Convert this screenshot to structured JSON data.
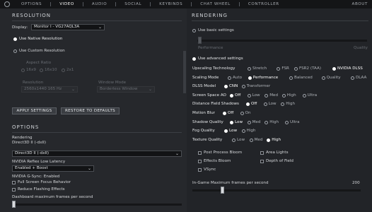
{
  "nav": {
    "tabs": [
      "OPTIONS",
      "VIDEO",
      "AUDIO",
      "SOCIAL",
      "KEYBINDS",
      "CHAT WHEEL",
      "CONTROLLER"
    ],
    "active": "VIDEO",
    "about": "ABOUT"
  },
  "resolution": {
    "title": "RESOLUTION",
    "display_label": "Display:",
    "display_value": "Monitor I - VG27AQL3A",
    "use_native": "Use Native Resolution",
    "use_custom": "Use Custom Resolution",
    "aspect_ratio_label": "Aspect Ratio",
    "aspect_options": [
      "16x9",
      "16x10",
      "2x1"
    ],
    "resolution_label": "Resolution",
    "resolution_value": "2560x1440 165 Hz",
    "window_mode_label": "Window Mode",
    "window_mode_value": "Borderless Window",
    "apply_button": "APPLY SETTINGS",
    "restore_button": "RESTORE TO DEFAULTS"
  },
  "options": {
    "title": "OPTIONS",
    "rendering_label": "Rendering",
    "rendering_value": "Direct3D II (-dxII)",
    "rendering_select": "Direct3D II (-dxII)",
    "reflex_label": "NVIDIA Reflex Low Latency",
    "reflex_value": "Enabled + Boost",
    "gsync_label": "NVIDIA G-Sync: Enabled",
    "fullscreen_focus": "Full Screen Focus Behavior",
    "reduce_flashing": "Reduce Flashing Effects",
    "dashboard_fps": "Dashboard maximum frames per second"
  },
  "rendering": {
    "title": "RENDERING",
    "use_basic": "Use basic settings",
    "use_advanced": "Use advanced settings",
    "basic_scale_left": "Performance",
    "basic_scale_right": "Quality",
    "upscaling": {
      "label": "Upscaling Technology",
      "options": [
        "Stretch",
        "FSR",
        "FSR2 (TAA)",
        "NVIDIA DLSS"
      ],
      "selected": 3
    },
    "scaling_mode": {
      "label": "Scaling Mode",
      "options": [
        "Auto",
        "Performance",
        "Balanced",
        "Quality",
        "DLAA"
      ],
      "selected": 1
    },
    "dlss_model": {
      "label": "DLSS Model",
      "options": [
        "CNN",
        "Transformer"
      ],
      "selected": 0
    },
    "ssao": {
      "label": "Screen Space AO",
      "options": [
        "Off",
        "Low",
        "Med",
        "High",
        "Ultra"
      ],
      "selected": 0
    },
    "dfs": {
      "label": "Distance Field Shadows",
      "options": [
        "Off",
        "Low",
        "High"
      ],
      "selected": 0
    },
    "motion_blur": {
      "label": "Motion Blur",
      "options": [
        "Off",
        "On"
      ],
      "selected": 0
    },
    "shadow_quality": {
      "label": "Shadow Quality",
      "options": [
        "Low",
        "Med",
        "High",
        "Ultra"
      ],
      "selected": 0
    },
    "fog_quality": {
      "label": "Fog Quality",
      "options": [
        "Low",
        "High"
      ],
      "selected": 0
    },
    "texture_quality": {
      "label": "Texture Quality",
      "options": [
        "Low",
        "Med",
        "High"
      ],
      "selected": 2
    },
    "checkboxes": [
      "Post Process Bloom",
      "Area Lights",
      "Effects Bloom",
      "Depth of Field",
      "VSync"
    ],
    "ingame_fps_label": "In-Game Maximum frames per second",
    "ingame_fps_value": "200",
    "ingame_fps_fraction": 0.17
  }
}
